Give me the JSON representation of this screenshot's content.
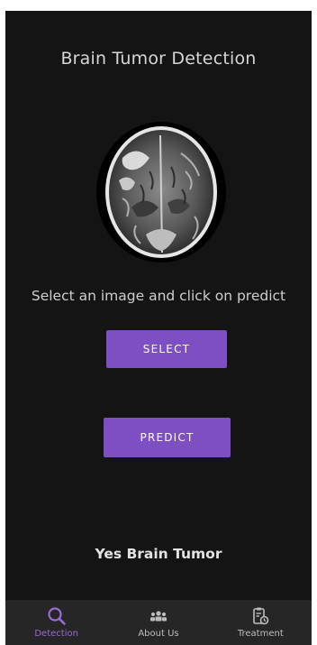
{
  "app": {
    "title": "Brain Tumor Detection",
    "hint": "Select an image and click on predict",
    "result": "Yes Brain Tumor"
  },
  "buttons": {
    "select_label": "SELECT",
    "predict_label": "PREDICT"
  },
  "navbar": {
    "items": [
      {
        "label": "Detection",
        "icon": "search-icon",
        "active": true
      },
      {
        "label": "About Us",
        "icon": "people-icon",
        "active": false
      },
      {
        "label": "Treatment",
        "icon": "clipboard-icon",
        "active": false
      }
    ]
  },
  "colors": {
    "background": "#141414",
    "accent": "#7e4fc2",
    "active_tab": "#9a6ad6",
    "navbar": "#262626"
  }
}
